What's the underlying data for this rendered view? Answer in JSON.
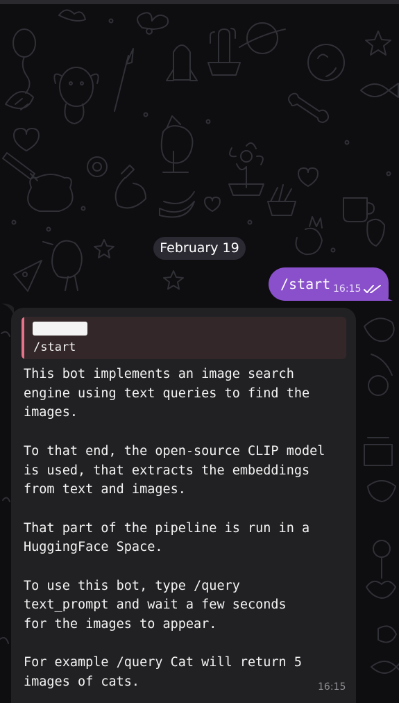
{
  "chat": {
    "date_label": "February 19",
    "outgoing": {
      "text": "/start",
      "time": "16:15",
      "status": "read"
    },
    "incoming": {
      "reply": {
        "sender_redacted": true,
        "text": "/start"
      },
      "paragraphs": [
        {
          "lines": [
            "This bot implements an image search",
            "engine using text queries to find the",
            "images."
          ]
        },
        {
          "lines": [
            "To that end, the open-source CLIP model",
            "is used, that extracts the embeddings",
            "from text and images."
          ]
        },
        {
          "lines": [
            "That part of the pipeline is run in a",
            "HuggingFace Space."
          ]
        },
        {
          "lines": [
            "To use this bot, type /query",
            "text_prompt and wait a few seconds",
            "for the images to appear."
          ]
        },
        {
          "lines": [
            "For example /query Cat will return 5",
            "images of cats."
          ]
        }
      ],
      "time": "16:15"
    }
  },
  "colors": {
    "background": "#0e0e10",
    "outgoing_bubble": "#8a50cc",
    "incoming_bubble": "#212123",
    "reply_accent": "#e7738a",
    "reply_background": "#332729",
    "date_chip": "#2b2a33"
  },
  "icons": {
    "read_receipt": "double-check-icon",
    "wallpaper": "doodle-pattern"
  }
}
